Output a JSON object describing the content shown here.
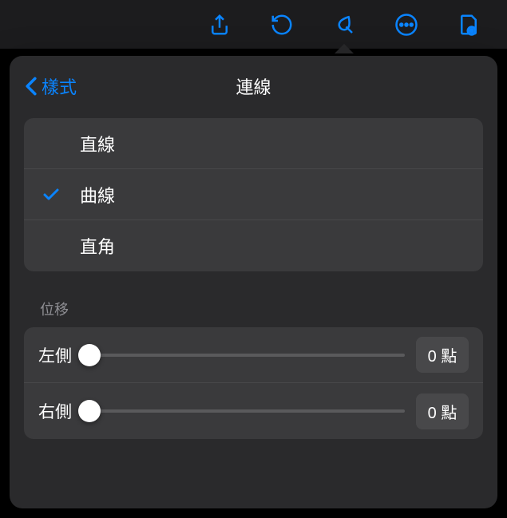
{
  "toolbar": {
    "icons": [
      "share",
      "undo",
      "format",
      "more",
      "document"
    ]
  },
  "popover": {
    "back_label": "樣式",
    "title": "連線"
  },
  "line_types": {
    "items": [
      {
        "label": "直線",
        "selected": false
      },
      {
        "label": "曲線",
        "selected": true
      },
      {
        "label": "直角",
        "selected": false
      }
    ]
  },
  "offset": {
    "section_label": "位移",
    "sliders": [
      {
        "label": "左側",
        "value": 0,
        "display": "0 點"
      },
      {
        "label": "右側",
        "value": 0,
        "display": "0 點"
      }
    ]
  }
}
